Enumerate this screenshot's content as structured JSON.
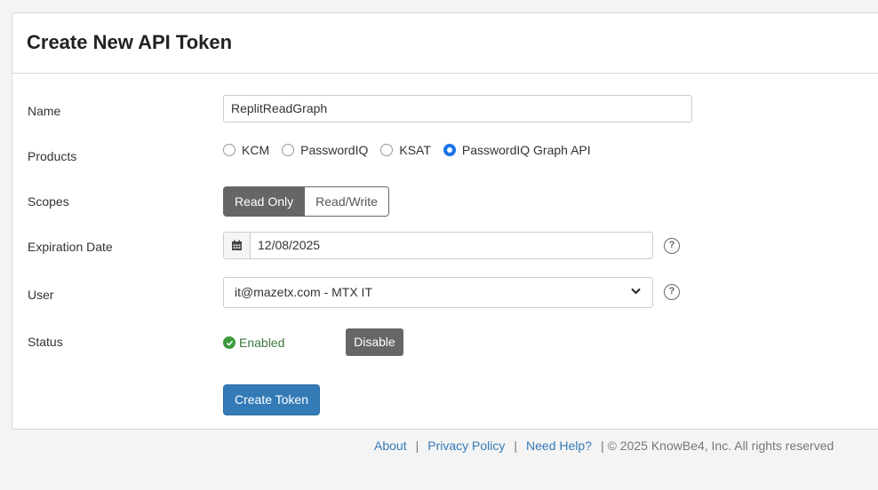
{
  "header": {
    "title": "Create New API Token"
  },
  "form": {
    "name": {
      "label": "Name",
      "value": "ReplitReadGraph"
    },
    "products": {
      "label": "Products",
      "options": [
        "KCM",
        "PasswordIQ",
        "KSAT",
        "PasswordIQ Graph API"
      ],
      "selected": "PasswordIQ Graph API"
    },
    "scopes": {
      "label": "Scopes",
      "options": [
        "Read Only",
        "Read/Write"
      ],
      "selected": "Read Only"
    },
    "expiration": {
      "label": "Expiration Date",
      "value": "12/08/2025",
      "help": "?"
    },
    "user": {
      "label": "User",
      "value": "it@mazetx.com - MTX IT",
      "help": "?"
    },
    "status": {
      "label": "Status",
      "value": "Enabled",
      "action": "Disable"
    },
    "submit": "Create Token"
  },
  "footer": {
    "links": [
      "About",
      "Privacy Policy",
      "Need Help?"
    ],
    "separator": "|",
    "copyright": "© 2025 KnowBe4, Inc. All rights reserved"
  },
  "colors": {
    "primary": "#337ab7",
    "radio_checked": "#1a73e8",
    "enabled": "#3c763d",
    "dark_button": "#666666"
  },
  "icons": [
    "calendar-icon",
    "help-icon",
    "chevron-down-icon",
    "check-circle-icon"
  ]
}
